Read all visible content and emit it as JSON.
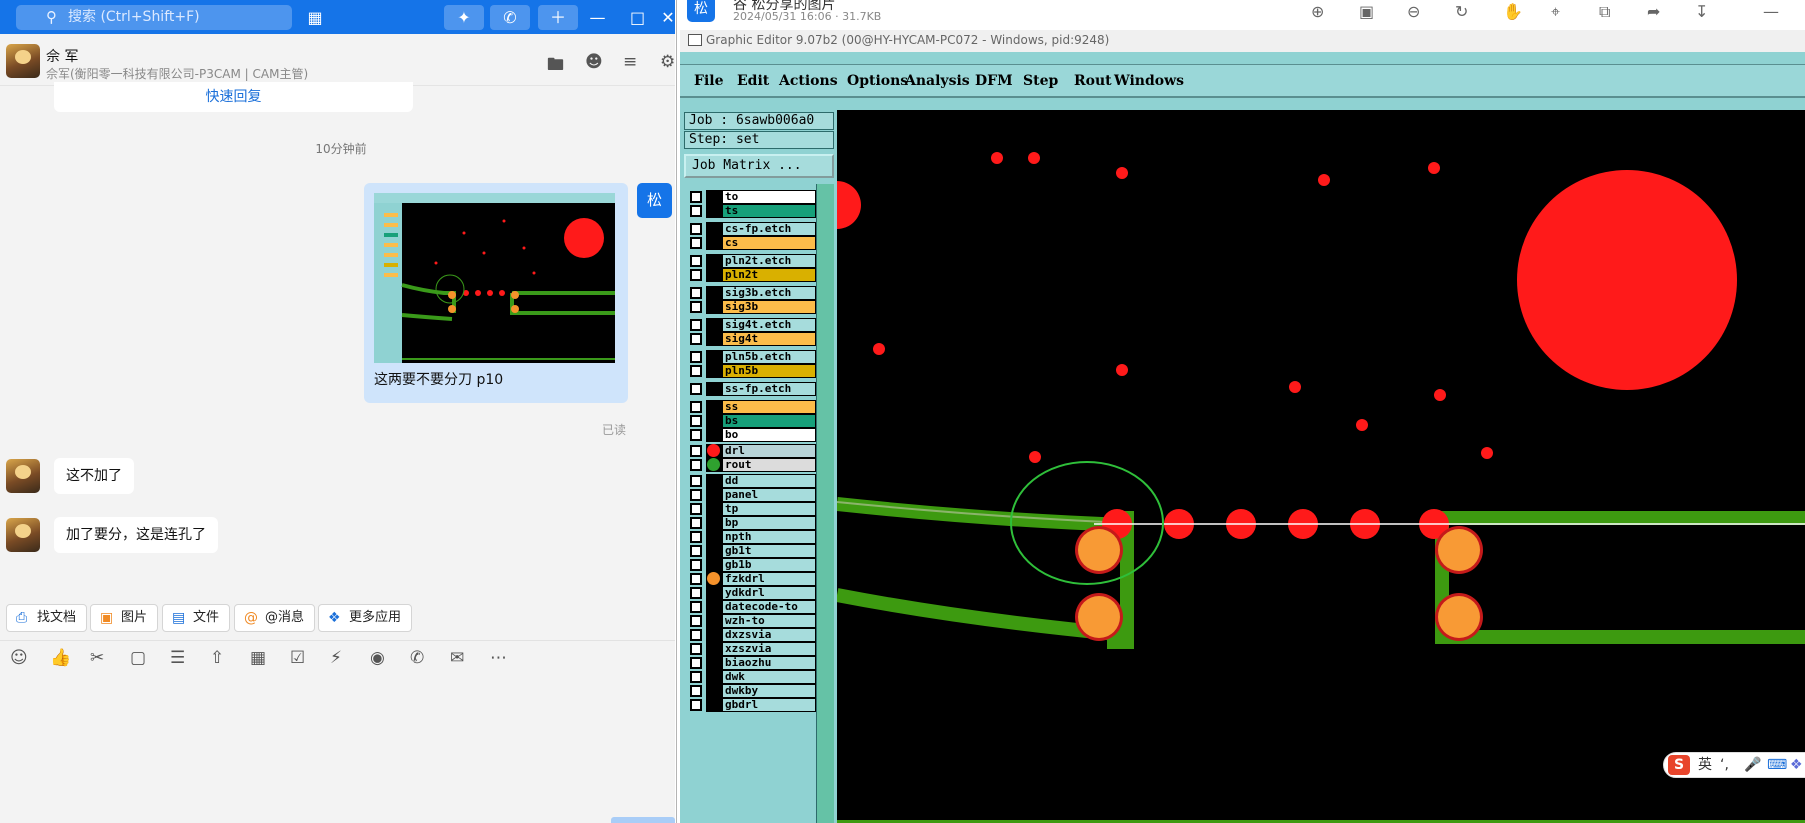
{
  "chat": {
    "search_placeholder": "搜索 (Ctrl+Shift+F)",
    "header": {
      "name": "佘 军",
      "subtitle": "佘军(衡阳零一科技有限公司-P3CAM | CAM主管)"
    },
    "quick_reply": "快速回复",
    "time_separator": "10分钟前",
    "self_avatar": "松",
    "image_caption": "这两要不要分刀 p10",
    "read_status": "已读",
    "messages": [
      {
        "text": "这不加了"
      },
      {
        "text": "加了要分，这是连孔了"
      }
    ],
    "chips": [
      "找文档",
      "图片",
      "文件",
      "@消息",
      "更多应用"
    ]
  },
  "viewer": {
    "badge": "松",
    "file_name": "谷 松分享的图片",
    "meta": "2024/05/31 16:06 · 31.7KB"
  },
  "editor": {
    "title": "Graphic Editor 9.07b2 (00@HY-HYCAM-PC072 - Windows, pid:9248)",
    "menu": [
      "File",
      "Edit",
      "Actions",
      "Options",
      "Analysis",
      "DFM",
      "Step",
      "Rout",
      "Windows"
    ],
    "job": "Job : 6sawb006a0",
    "step": "Step: set",
    "job_matrix": "Job Matrix ...",
    "layers": [
      {
        "name": "to",
        "color": "#ffffff"
      },
      {
        "name": "ts",
        "color": "#17a07a"
      },
      {
        "name": "cs-fp.etch",
        "color": "#a6dcdc"
      },
      {
        "name": "cs",
        "color": "#fcbd4a"
      },
      {
        "name": "pln2t.etch",
        "color": "#a6dcdc"
      },
      {
        "name": "pln2t",
        "color": "#d9b000"
      },
      {
        "name": "sig3b.etch",
        "color": "#a6dcdc"
      },
      {
        "name": "sig3b",
        "color": "#fcbd4a"
      },
      {
        "name": "sig4t.etch",
        "color": "#a6dcdc"
      },
      {
        "name": "sig4t",
        "color": "#fcbd4a"
      },
      {
        "name": "pln5b.etch",
        "color": "#a6dcdc"
      },
      {
        "name": "pln5b",
        "color": "#d9b000"
      },
      {
        "name": "ss-fp.etch",
        "color": "#a6dcdc"
      },
      {
        "name": "ss",
        "color": "#fcbd4a"
      },
      {
        "name": "bs",
        "color": "#17a07a"
      },
      {
        "name": "bo",
        "color": "#ffffff"
      },
      {
        "name": "drl",
        "color": "#b8d4d8",
        "dot": "#ff1a1a"
      },
      {
        "name": "rout",
        "color": "#dcdcdc",
        "dot": "#2fa12f"
      },
      {
        "name": "dd",
        "color": "#a6dcdc"
      },
      {
        "name": "panel",
        "color": "#a6dcdc"
      },
      {
        "name": "tp",
        "color": "#a6dcdc"
      },
      {
        "name": "bp",
        "color": "#a6dcdc"
      },
      {
        "name": "npth",
        "color": "#a6dcdc"
      },
      {
        "name": "gb1t",
        "color": "#a6dcdc"
      },
      {
        "name": "gb1b",
        "color": "#a6dcdc"
      },
      {
        "name": "fzkdrl",
        "color": "#a6dcdc",
        "dot": "#f5922b"
      },
      {
        "name": "ydkdrl",
        "color": "#a6dcdc"
      },
      {
        "name": "datecode-to",
        "color": "#a6dcdc"
      },
      {
        "name": "wzh-to",
        "color": "#a6dcdc"
      },
      {
        "name": "dxzsvia",
        "color": "#a6dcdc"
      },
      {
        "name": "xzszvia",
        "color": "#a6dcdc"
      },
      {
        "name": "biaozhu",
        "color": "#a6dcdc"
      },
      {
        "name": "dwk",
        "color": "#a6dcdc"
      },
      {
        "name": "dwkby",
        "color": "#a6dcdc"
      },
      {
        "name": "gbdrl",
        "color": "#a6dcdc"
      }
    ]
  },
  "ime": {
    "label": "英"
  }
}
